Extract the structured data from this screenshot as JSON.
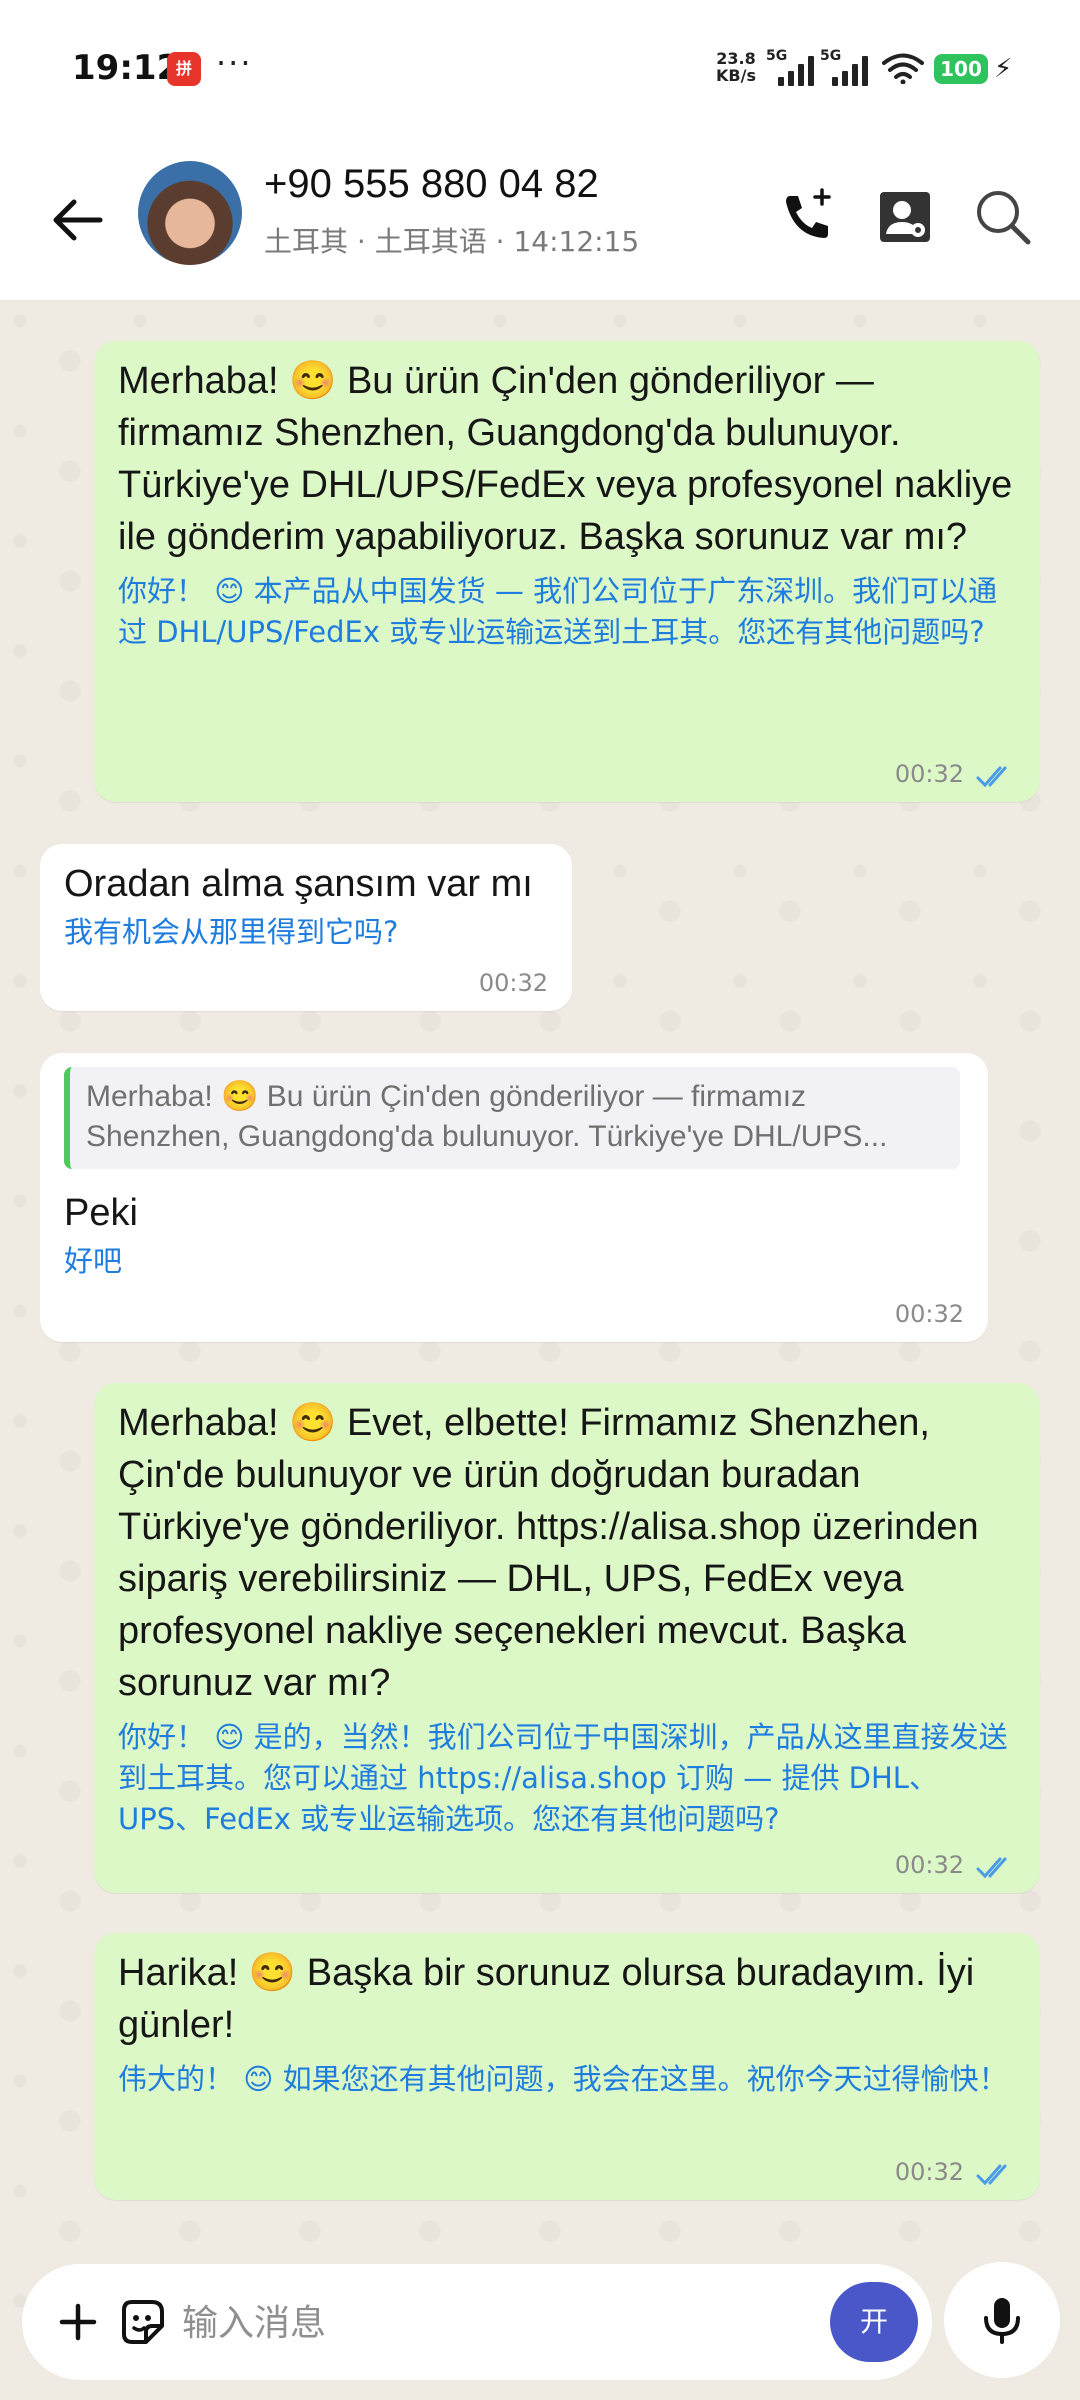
{
  "status_bar": {
    "time": "19:12",
    "app_badge": "拼多多",
    "more": "···",
    "speed_value": "23.8",
    "speed_unit": "KB/s",
    "net1": "5G",
    "net2": "5G",
    "battery": "100"
  },
  "header": {
    "contact_name": "+90 555 880 04 82",
    "country": "土耳其",
    "language": "土耳其语",
    "local_time": "14:12:15",
    "separator": "·"
  },
  "messages": [
    {
      "direction": "outgoing",
      "text": "Merhaba! 😊 Bu ürün Çin'den gönderiliyor — firmamız Shenzhen, Guangdong'da bulunuyor. Türkiye'ye DHL/UPS/FedEx veya profesyonel nakliye ile gönderim yapabiliyoruz. Başka sorunuz var mı?",
      "translation": "你好！ 😊 本产品从中国发货 — 我们公司位于广东深圳。我们可以通过 DHL/UPS/FedEx 或专业运输运送到土耳其。您还有其他问题吗?",
      "time": "00:32"
    },
    {
      "direction": "incoming",
      "text": "Oradan alma şansım var mı",
      "translation": "我有机会从那里得到它吗?",
      "time": "00:32"
    },
    {
      "direction": "incoming",
      "quote": "Merhaba! 😊 Bu ürün Çin'den gönderiliyor — firmamız Shenzhen, Guangdong'da bulunuyor. Türkiye'ye DHL/UPS...",
      "text": "Peki",
      "translation": "好吧",
      "time": "00:32"
    },
    {
      "direction": "outgoing",
      "text": "Merhaba! 😊 Evet, elbette! Firmamız Shenzhen, Çin'de bulunuyor ve ürün doğrudan buradan Türkiye'ye gönderiliyor. https://alisa.shop üzerinden sipariş verebilirsiniz — DHL, UPS, FedEx veya profesyonel nakliye seçenekleri mevcut. Başka sorunuz var mı?",
      "translation": "你好！ 😊 是的，当然！我们公司位于中国深圳，产品从这里直接发送到土耳其。您可以通过 https://alisa.shop 订购 — 提供 DHL、UPS、FedEx 或专业运输选项。您还有其他问题吗?",
      "time": "00:32"
    },
    {
      "direction": "outgoing",
      "text": "Harika! 😊 Başka bir sorunuz olursa buradayım. İyi günler!",
      "translation": "伟大的！ 😊 如果您还有其他问题，我会在这里。祝你今天过得愉快！",
      "time": "00:32"
    }
  ],
  "input": {
    "placeholder": "输入消息",
    "toggle_label": "开"
  },
  "colors": {
    "outgoing_bubble": "#dcf8c6",
    "incoming_bubble": "#ffffff",
    "translation_text": "#1e7dde",
    "read_ticks": "#4a9be8",
    "quote_bar": "#4fc95c",
    "toggle_button": "#4a57c9",
    "battery": "#2fc35e"
  },
  "icons": {
    "back": "arrow-left-icon",
    "call": "phone-add-icon",
    "contact": "contact-settings-icon",
    "search": "search-icon",
    "attach": "plus-icon",
    "sticker": "sticker-icon",
    "mic": "mic-icon",
    "read": "double-check-icon"
  }
}
